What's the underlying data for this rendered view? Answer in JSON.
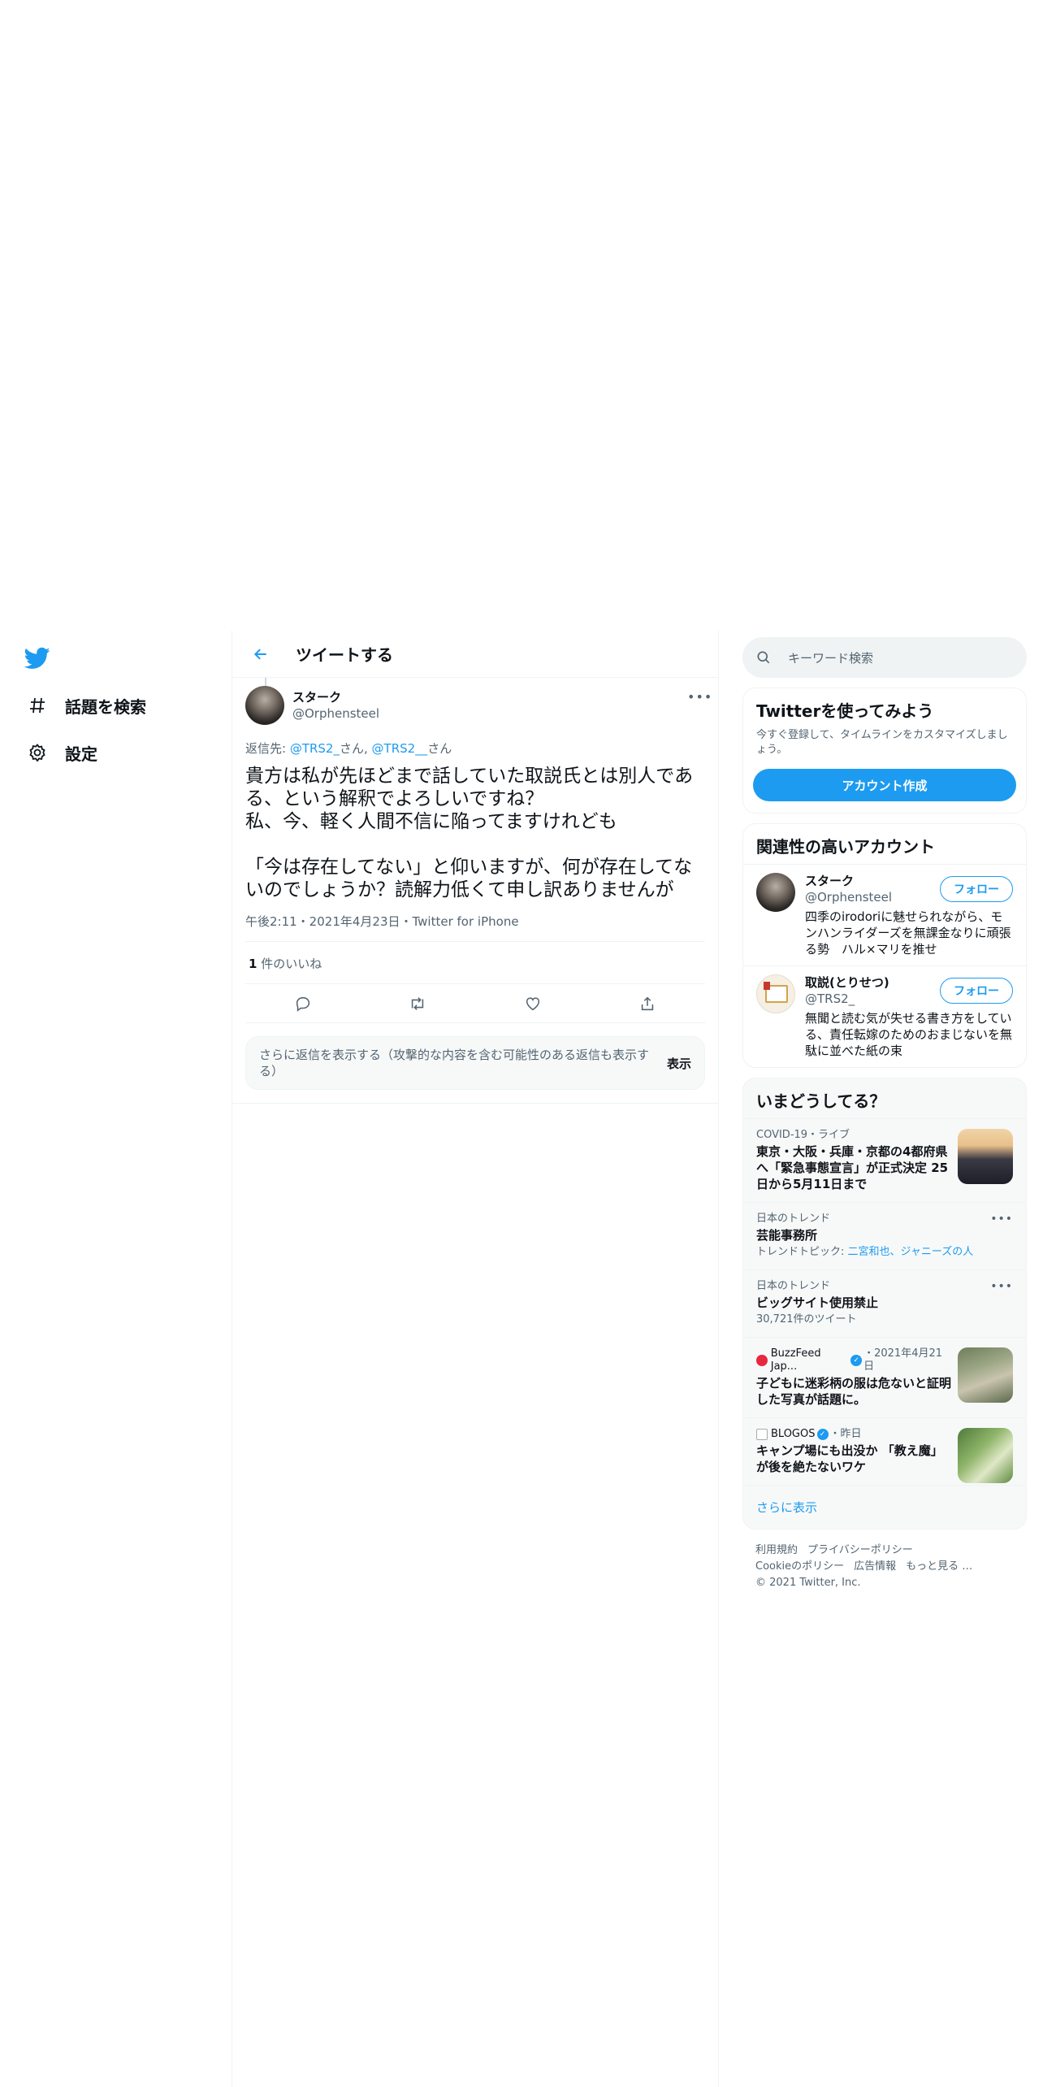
{
  "nav": {
    "items": [
      {
        "label": "話題を検索",
        "icon": "hashtag-icon"
      },
      {
        "label": "設定",
        "icon": "gear-icon"
      }
    ]
  },
  "header": {
    "title": "ツイートする"
  },
  "tweet": {
    "display_name": "スターク",
    "handle": "@Orphensteel",
    "reply_to_prefix": "返信先: ",
    "reply_to_1": "@TRS2_",
    "reply_to_1_suffix": "さん, ",
    "reply_to_2": "@TRS2__",
    "reply_to_2_suffix": "さん",
    "text": "貴方は私が先ほどまで話していた取説氏とは別人である、という解釈でよろしいですね？\n私、今、軽く人間不信に陥ってますけれども\n\n「今は存在してない」と仰いますが、何が存在してないのでしょうか？読解力低くて申し訳ありませんが",
    "meta": "午後2:11・2021年4月23日・Twitter for iPhone",
    "like_count": "1",
    "like_label": " 件のいいね"
  },
  "more_replies": {
    "text": "さらに返信を表示する（攻撃的な内容を含む可能性のある返信も表示する）",
    "button": "表示"
  },
  "search": {
    "placeholder": "キーワード検索"
  },
  "tryit": {
    "title": "Twitterを使ってみよう",
    "desc": "今すぐ登録して、タイムラインをカスタマイズしましょう。",
    "button": "アカウント作成"
  },
  "related": {
    "title": "関連性の高いアカウント",
    "accounts": [
      {
        "name": "スターク",
        "handle": "@Orphensteel",
        "bio": "四季のirodoriに魅せられながら、モンハンライダーズを無課金なりに頑張る勢　ハル×マリを推せ",
        "follow": "フォロー"
      },
      {
        "name": "取説(とりせつ)",
        "handle": "@TRS2_",
        "bio": "無聞と読む気が失せる書き方をしている、責任転嫁のためのおまじないを無駄に並べた紙の束",
        "follow": "フォロー"
      }
    ]
  },
  "trends": {
    "title": "いまどうしてる？",
    "items": [
      {
        "meta": "COVID-19・ライブ",
        "title": "東京・大阪・兵庫・京都の4都府県へ「緊急事態宣言」が正式決定 25日から5月11日まで",
        "sub": ""
      },
      {
        "meta": "日本のトレンド",
        "title": "芸能事務所",
        "sub_prefix": "トレンドトピック: ",
        "sub_link": "二宮和也、ジャニーズの人"
      },
      {
        "meta": "日本のトレンド",
        "title": "ビッグサイト使用禁止",
        "sub": "30,721件のツイート"
      },
      {
        "source": "BuzzFeed Jap...",
        "meta_suffix": "・2021年4月21日",
        "title": "子どもに迷彩柄の服は危ないと証明した写真が話題に。"
      },
      {
        "source": "BLOGOS",
        "meta_suffix": "・昨日",
        "title": "キャンプ場にも出没か 「教え魔」が後を絶たないワケ"
      }
    ],
    "show_more": "さらに表示"
  },
  "footer": {
    "links": [
      "利用規約",
      "プライバシーポリシー",
      "Cookieのポリシー",
      "広告情報",
      "もっと見る …"
    ],
    "copyright": "© 2021 Twitter, Inc."
  },
  "colors": {
    "accent": "#1d9bf0",
    "text": "#0f1419",
    "muted": "#536471",
    "border": "#eff3f4"
  }
}
